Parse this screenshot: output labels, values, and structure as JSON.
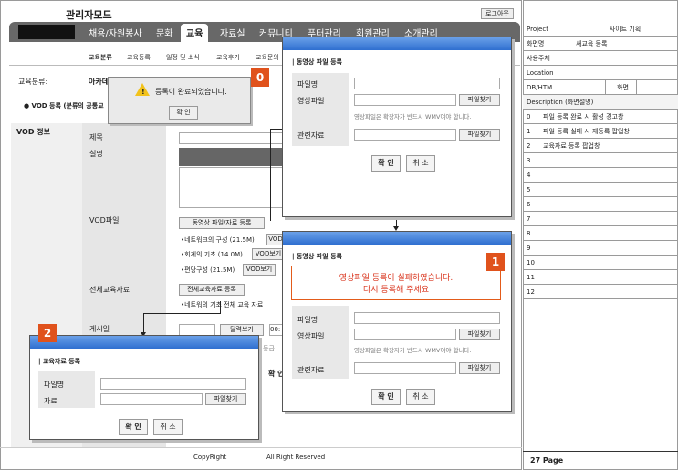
{
  "app": {
    "title": "관리자모드",
    "logout": "로그아웃"
  },
  "nav": {
    "items": [
      "채용/자원봉사",
      "문화",
      "교육",
      "자료실",
      "커뮤니티",
      "푸터관리",
      "회원관리",
      "소개관리"
    ],
    "active": "교육"
  },
  "subnav": {
    "items": [
      "교육분류",
      "교육등록",
      "일정 및 소식",
      "교육후기",
      "교육문의"
    ],
    "active": "교육분류"
  },
  "page": {
    "category_label": "교육분류:",
    "category_value": "아카데",
    "vod_notice": "● VOD 등록 (분류의 공통교",
    "section": "VOD 정보",
    "fields": {
      "title": "제목",
      "desc": "설명",
      "vod_file": "VOD파일",
      "all_material": "전체교육자료",
      "post_date": "게시일"
    },
    "vod_file_btn": "동영상 파일/자료 등록",
    "vod_items": [
      "•네트워크의 구성 (21.5M)",
      "•회계의 기초 (14.0M)",
      "•편당구성 (21.5M)"
    ],
    "vod_view": "VOD보기",
    "vod_view_short": "VOD",
    "material_btn": "전체교육자료 등록",
    "material_item": "•네트워의 기초 전체 교육 자료",
    "calendar_btn": "달력보기",
    "time_val": "00:",
    "bottom_stub": "등급",
    "bottom_btn_stub": "확 인"
  },
  "footer": {
    "copyright": "CopyRight",
    "rights": "All Right Reserved"
  },
  "alert": {
    "message": "등록이 완료되었습니다.",
    "ok": "확 인"
  },
  "popup_upload": {
    "title": "| 동영상 파일 등록",
    "file_name": "파일명",
    "video_file": "영상파일",
    "related": "관련자료",
    "find": "파일찾기",
    "hint": "영상파일은 확장자가 반드시 WMV여야 합니다.",
    "ok": "확 인",
    "cancel": "취 소"
  },
  "popup_fail": {
    "title": "| 동영상 파일 등록",
    "error_line1": "영상파일 등록이 실패하였습니다.",
    "error_line2": "다시 등록해 주세요",
    "file_name": "파일명",
    "video_file": "영상파일",
    "related": "관련자료",
    "find": "파일찾기",
    "hint": "영상파일은 확장자가 반드시 WMV여야 합니다.",
    "ok": "확 인",
    "cancel": "취 소"
  },
  "popup_material": {
    "title": "| 교육자료 등록",
    "file_name": "파일명",
    "material": "자료",
    "find": "파일찾기",
    "ok": "확 인",
    "cancel": "취 소"
  },
  "markers": [
    "0",
    "1",
    "2"
  ],
  "spec": {
    "project_label": "Project",
    "project_value": "사이트 기획",
    "screen_label": "화면명",
    "screen_value": "새교육 등록",
    "owner_label": "사용주체",
    "location_label": "Location",
    "db_label": "DB/HTM",
    "screen2_label": "화면",
    "desc_header": "Description (화면설명)",
    "rows": [
      {
        "no": "0",
        "text": "파일 등록 완료 시 활성 경고창"
      },
      {
        "no": "1",
        "text": "파일 등록 실패 시 재등록 팝업창"
      },
      {
        "no": "2",
        "text": "교육자료 등록 팝업창"
      },
      {
        "no": "3",
        "text": ""
      },
      {
        "no": "4",
        "text": ""
      },
      {
        "no": "5",
        "text": ""
      },
      {
        "no": "6",
        "text": ""
      },
      {
        "no": "7",
        "text": ""
      },
      {
        "no": "8",
        "text": ""
      },
      {
        "no": "9",
        "text": ""
      },
      {
        "no": "10",
        "text": ""
      },
      {
        "no": "11",
        "text": ""
      },
      {
        "no": "12",
        "text": ""
      }
    ],
    "page": "27 Page"
  },
  "colors": {
    "accent": "#2f6fd0",
    "marker": "#e0521c",
    "nav": "#686868"
  }
}
